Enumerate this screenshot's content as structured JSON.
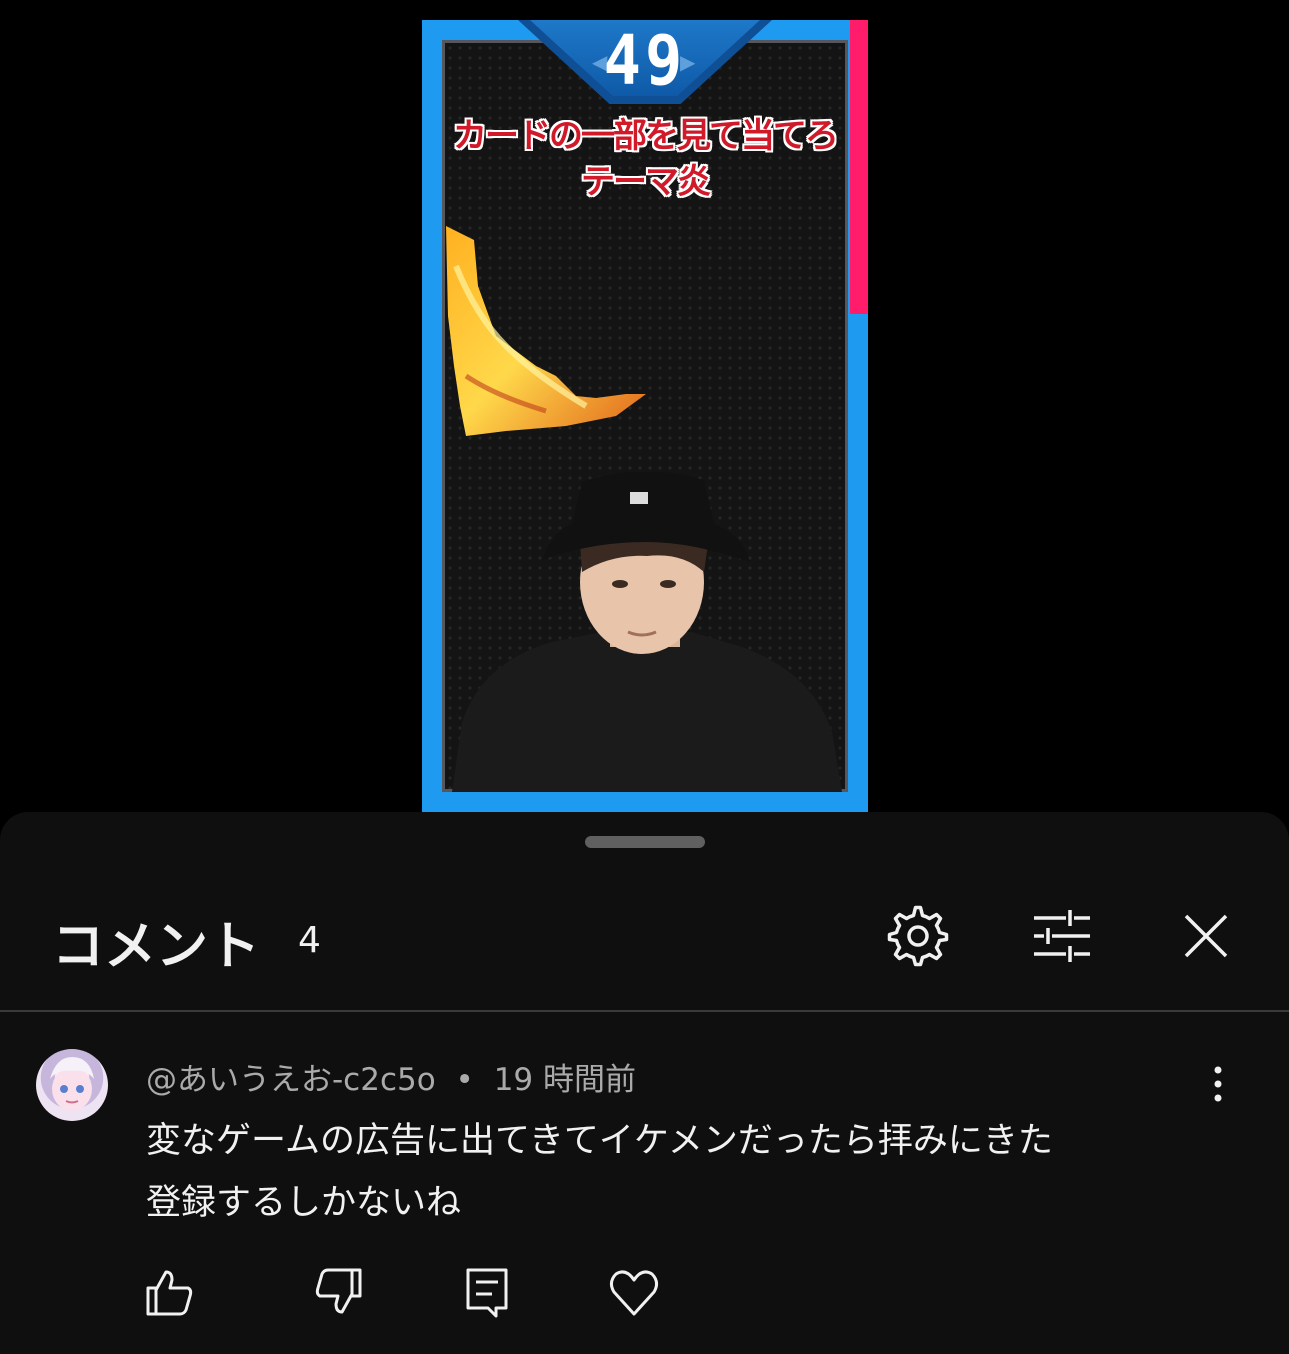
{
  "video": {
    "question_number": "49",
    "quiz_line1": "カードの一部を見て当てろ",
    "quiz_line2": "テーマ炎",
    "colors": {
      "frame_blue": "#1e9bf0",
      "frame_pink": "#ff1d6b",
      "quiz_red": "#d01a2a"
    }
  },
  "comments_panel": {
    "title": "コメント",
    "count": "4",
    "settings_icon": "gear-icon",
    "filter_icon": "sliders-icon",
    "close_icon": "close-icon"
  },
  "comment": {
    "author": "@あいうえお-c2c5o",
    "separator": "•",
    "timestamp": "19 時間前",
    "text_line1": "変なゲームの広告に出てきてイケメンだったら拝みにきた",
    "text_line2": "登録するしかないね",
    "actions": [
      "thumbs-up-icon",
      "thumbs-down-icon",
      "reply-icon",
      "heart-icon"
    ],
    "more_icon": "more-vertical-icon"
  }
}
